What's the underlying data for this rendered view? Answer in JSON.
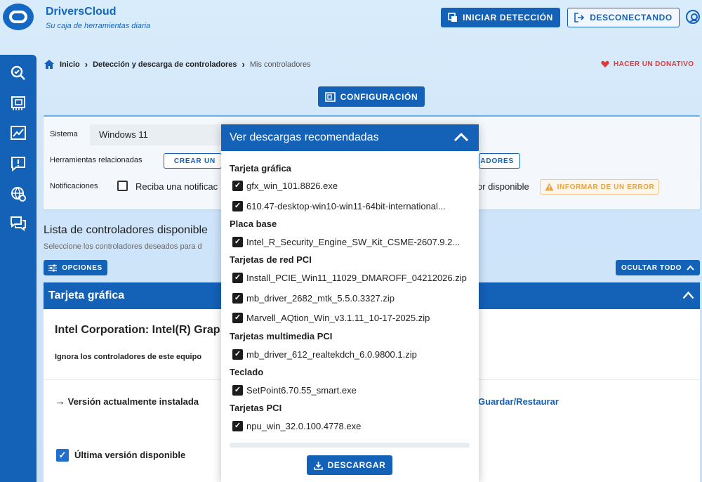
{
  "brand": {
    "name": "DriversCloud",
    "tagline": "Su caja de herramientas diaria"
  },
  "header": {
    "detect_label": "INICIAR DETECCIÓN",
    "disconnect_label": "DESCONECTANDO"
  },
  "breadcrumb": {
    "home": "Inicio",
    "section": "Detección y descarga de controladores",
    "current": "Mis controladores"
  },
  "donate_label": "HACER UN DONATIVO",
  "config_label": "CONFIGURACIÓN",
  "system_card": {
    "system_label": "Sistema",
    "system_value": "Windows 11",
    "tools_label": "Herramientas relacionadas",
    "create_button": "CREAR UN",
    "controllers_button": "LADORES",
    "notifications_label": "Notificaciones",
    "notify_text": "Reciba una notificac",
    "notify_text_end": "or disponible",
    "report_error_label": "INFORMAR DE UN ERROR"
  },
  "list": {
    "title": "Lista de controladores disponible",
    "subtitle": "Seleccione los controladores deseados para d",
    "options_label": "OPCIONES",
    "hide_all_label": "OCULTAR TODO"
  },
  "section": {
    "title": "Tarjeta gráfica",
    "device": "Intel Corporation: Intel(R) Grap",
    "ignore": "Ignora los controladores de este equipo",
    "installed": "Versión actualmente instalada",
    "backup_link": "Guardar/Restaurar",
    "latest": "Última versión disponible"
  },
  "modal": {
    "title": "Ver descargas recomendadas",
    "groups": [
      {
        "category": "Tarjeta gráfica",
        "files": [
          "gfx_win_101.8826.exe",
          "610.47-desktop-win10-win11-64bit-international..."
        ]
      },
      {
        "category": "Placa base",
        "files": [
          "Intel_R_Security_Engine_SW_Kit_CSME-2607.9.2..."
        ]
      },
      {
        "category": "Tarjetas de red PCI",
        "files": [
          "Install_PCIE_Win11_11029_DMAROFF_04212026.zip",
          "mb_driver_2682_mtk_5.5.0.3327.zip",
          "Marvell_AQtion_Win_v3.1.11_10-17-2025.zip"
        ]
      },
      {
        "category": "Tarjetas multimedia PCI",
        "files": [
          "mb_driver_612_realtekdch_6.0.9800.1.zip"
        ]
      },
      {
        "category": "Teclado",
        "files": [
          "SetPoint6.70.55_smart.exe"
        ]
      },
      {
        "category": "Tarjetas PCI",
        "files": [
          "npu_win_32.0.100.4778.exe"
        ]
      }
    ],
    "download_label": "DESCARGAR"
  },
  "colors": {
    "primary": "#1461b8",
    "donate": "#e03a3a",
    "warning": "#e8a33c"
  }
}
